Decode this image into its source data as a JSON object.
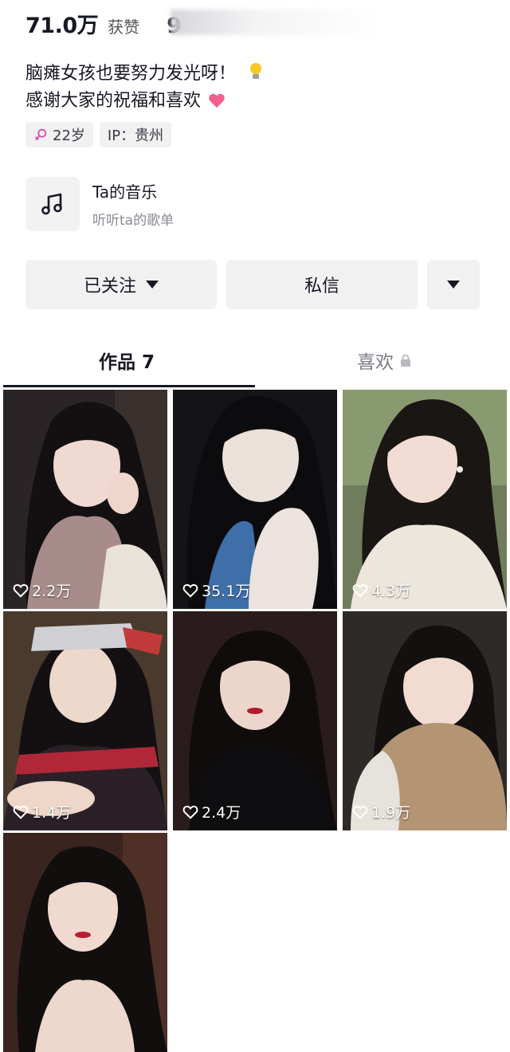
{
  "profile": {
    "likes_count": "71.0万",
    "likes_label": "获赞",
    "second_stat": "9",
    "bio_line1": "脑瘫女孩也要努力发光呀！",
    "bio_line2": "感谢大家的祝福和喜欢",
    "age_tag": "22岁",
    "ip_tag": "IP：贵州"
  },
  "music": {
    "title": "Ta的音乐",
    "subtitle": "听听ta的歌单"
  },
  "actions": {
    "follow_label": "已关注",
    "message_label": "私信"
  },
  "tabs": {
    "works_label": "作品 7",
    "likes_label": "喜欢"
  },
  "videos": [
    {
      "likes": "2.2万"
    },
    {
      "likes": "35.1万"
    },
    {
      "likes": "4.3万"
    },
    {
      "likes": "1.4万"
    },
    {
      "likes": "2.4万"
    },
    {
      "likes": "1.9万"
    },
    {
      "likes": ""
    }
  ],
  "colors": {
    "text": "#161823",
    "button_bg": "#f1f1f2",
    "heart_pink": "#f0608a",
    "female_icon": "#e04aa8"
  }
}
